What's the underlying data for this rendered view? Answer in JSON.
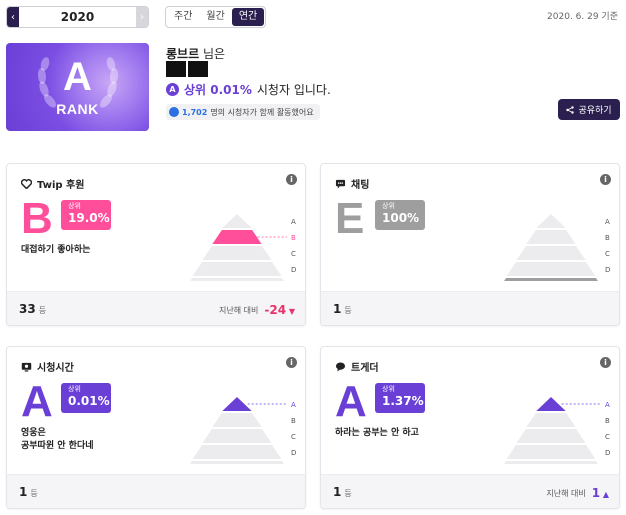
{
  "header": {
    "year": "2020",
    "tabs": [
      "주간",
      "월간",
      "연간"
    ],
    "active_tab": "연간",
    "date_ref": "2020. 6. 29 기준"
  },
  "rank": {
    "letter": "A",
    "label": "RANK",
    "streamer_nick": "롱브르",
    "streamer_suffix": "님은",
    "badge_letter": "A",
    "top_text": "상위 0.01%",
    "viewer_text": "시청자 입니다.",
    "viewer_count": "1,702",
    "viewer_rest": "명의 시청자가 함께 활동했어요"
  },
  "share_label": "공유하기",
  "colors": {
    "accent": "#6a3fd6",
    "pink": "#ff4f9b",
    "gray": "#9e9e9e",
    "navy": "#2a1f4e"
  },
  "levels": [
    "A",
    "B",
    "C",
    "D",
    "E"
  ],
  "cards": [
    {
      "title": "Twip 후원",
      "icon": "heart-icon",
      "grade": "B",
      "tag_label": "상위",
      "tag_value": "19.0%",
      "desc1": "대접하기 좋아하는",
      "desc2": "",
      "count": "33",
      "unit": "등",
      "compare_label": "지난해 대비",
      "delta": "-24",
      "delta_dir": "down",
      "highlight_level": "B"
    },
    {
      "title": "채팅",
      "icon": "chat-icon",
      "grade": "E",
      "tag_label": "상위",
      "tag_value": "100%",
      "desc1": "",
      "desc2": "",
      "count": "1",
      "unit": "등",
      "compare_label": "",
      "delta": "",
      "delta_dir": "",
      "highlight_level": "E"
    },
    {
      "title": "시청시간",
      "icon": "monitor-icon",
      "grade": "A",
      "tag_label": "상위",
      "tag_value": "0.01%",
      "desc1": "영웅은",
      "desc2": "공부따윈 안 한다네",
      "count": "1",
      "unit": "등",
      "compare_label": "",
      "delta": "",
      "delta_dir": "",
      "highlight_level": "A"
    },
    {
      "title": "트게더",
      "icon": "speech-bubble-icon",
      "grade": "A",
      "tag_label": "상위",
      "tag_value": "1.37%",
      "desc1": "하라는 공부는 안 하고",
      "desc2": "",
      "count": "1",
      "unit": "등",
      "compare_label": "지난해 대비",
      "delta": "1",
      "delta_dir": "up",
      "highlight_level": "A"
    }
  ]
}
